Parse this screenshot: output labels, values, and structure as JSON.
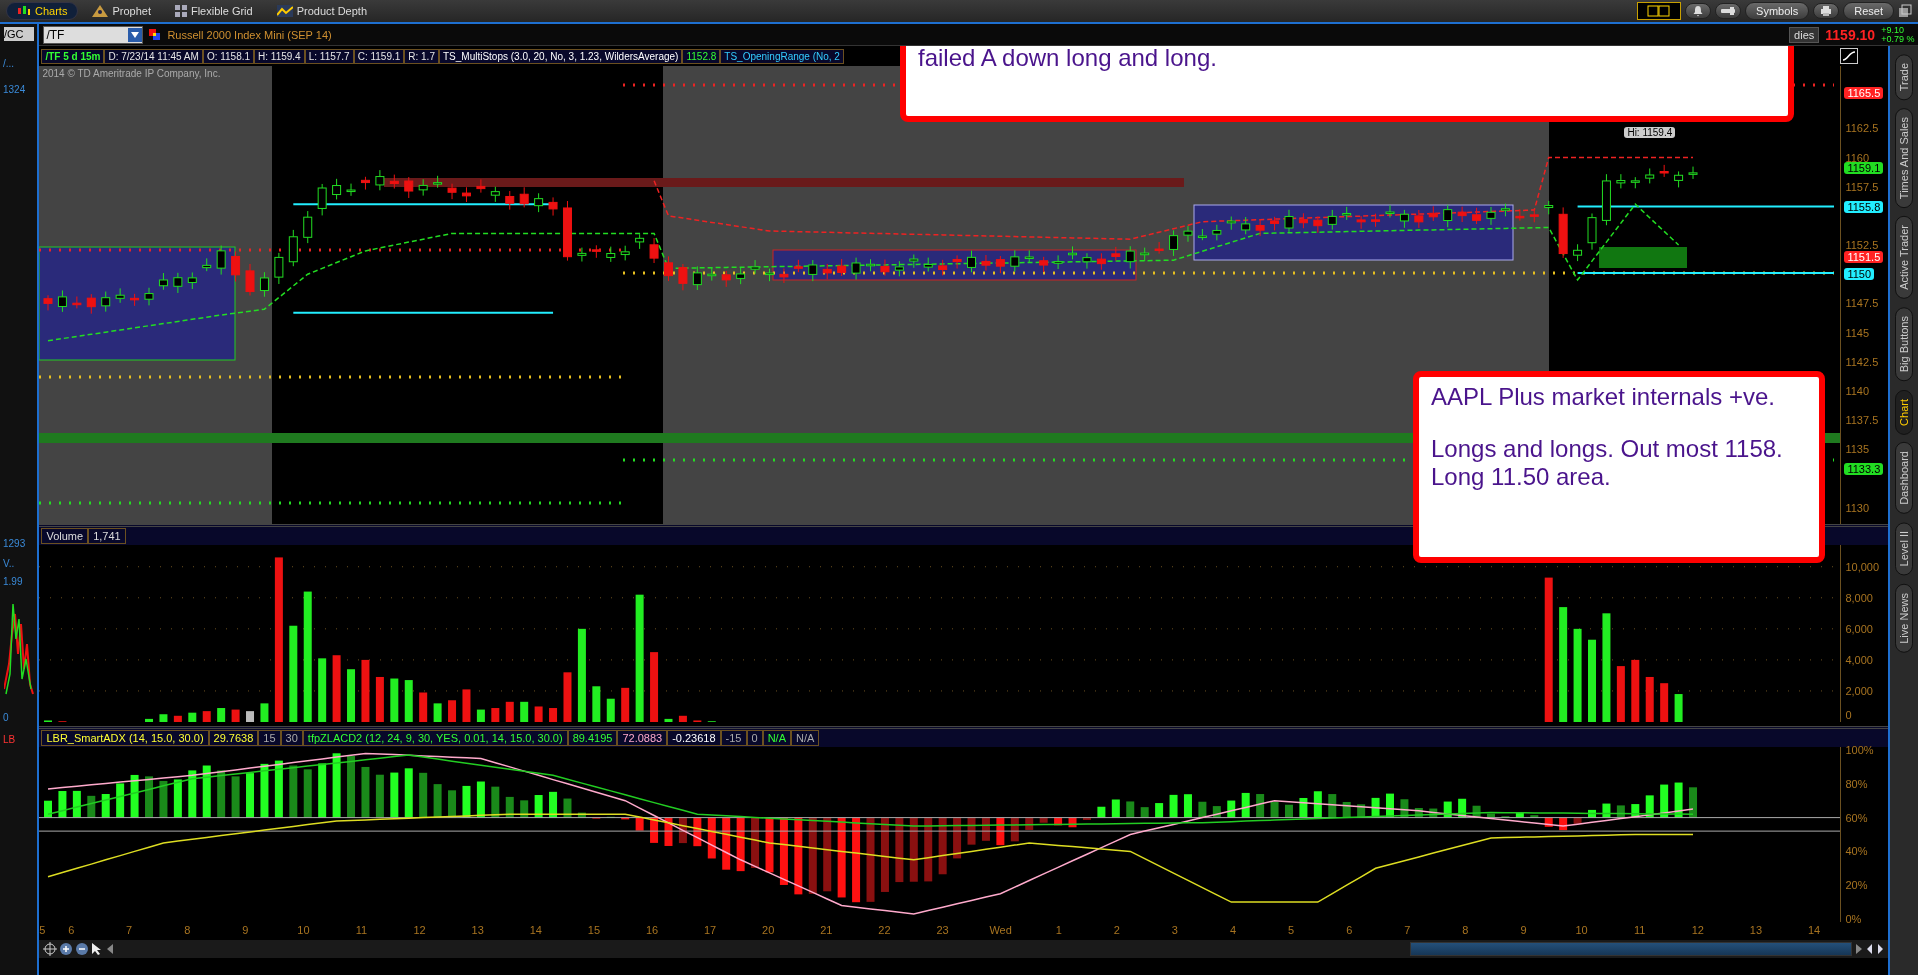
{
  "toolbar": {
    "tabs": [
      {
        "label": "Charts",
        "selected": true
      },
      {
        "label": "Prophet",
        "selected": false
      },
      {
        "label": "Flexible Grid",
        "selected": false
      },
      {
        "label": "Product Depth",
        "selected": false
      }
    ],
    "buttons": [
      "Symbols",
      "Reset"
    ]
  },
  "left_strip": {
    "symbol": "/GC",
    "texts": [
      "/...",
      "1324",
      "1293",
      "V..",
      "1.99",
      "0",
      "LB"
    ]
  },
  "chart": {
    "symbol": "/TF",
    "description": "Russell 2000 Index Mini (SEP 14)",
    "studies_button": "dies",
    "last": "1159.10",
    "change": "+9.10",
    "change_pct": "+0.79 %",
    "info": [
      {
        "text": "/TF 5 d 15m",
        "kind": "period"
      },
      {
        "text": "D: 7/23/14 11:45 AM",
        "kind": "field"
      },
      {
        "text": "O: 1158.1",
        "kind": "field"
      },
      {
        "text": "H: 1159.4",
        "kind": "field"
      },
      {
        "text": "L: 1157.7",
        "kind": "field"
      },
      {
        "text": "C: 1159.1",
        "kind": "field"
      },
      {
        "text": "R: 1.7",
        "kind": "field"
      },
      {
        "text": "TS_MultiStops (3.0, 20, No, 3, 1.23, WildersAverage)",
        "kind": "study"
      },
      {
        "text": "1152.8",
        "kind": "value"
      },
      {
        "text": "TS_OpeningRange (No, 2",
        "kind": "study2"
      }
    ],
    "copyright": "2014 © TD Ameritrade IP Company, Inc.",
    "high_label": "Hi: 1159.4",
    "price_axis": [
      "1162.5",
      "1160",
      "1157.5",
      "1152.5",
      "1147.5",
      "1145",
      "1142.5",
      "1140",
      "1137.5",
      "1135",
      "1130"
    ],
    "badges": [
      {
        "text": "1165.5",
        "color": "#ff2222"
      },
      {
        "text": "1159.1",
        "color": "#22dd22"
      },
      {
        "text": "1155.8",
        "color": "#22eeff"
      },
      {
        "text": "1151.5",
        "color": "#ff2222"
      },
      {
        "text": "1150",
        "color": "#22eeff"
      },
      {
        "text": "1133.3",
        "color": "#22dd22"
      }
    ]
  },
  "volume": {
    "title": "Volume",
    "value": "1,741",
    "axis": [
      "10,000",
      "8,000",
      "6,000",
      "4,000",
      "2,000",
      "0"
    ]
  },
  "indicator": {
    "cells": [
      {
        "text": "LBR_SmartADX (14, 15.0, 30.0)",
        "color": "#ffff33"
      },
      {
        "text": "29.7638",
        "color": "#ffff33"
      },
      {
        "text": "15",
        "color": "#aaaaaa"
      },
      {
        "text": "30",
        "color": "#aaaaaa"
      },
      {
        "text": "tfpZLACD2 (12, 24, 9, 30, YES, 0.01, 14, 15.0, 30.0)",
        "color": "#33ff33"
      },
      {
        "text": "89.4195",
        "color": "#33ff33"
      },
      {
        "text": "72.0883",
        "color": "#ffaacc"
      },
      {
        "text": "-0.23618",
        "color": "#ffffff"
      },
      {
        "text": "-15",
        "color": "#aaaaaa"
      },
      {
        "text": "0",
        "color": "#aaaaaa"
      },
      {
        "text": "N/A",
        "color": "#33ff33"
      },
      {
        "text": "N/A",
        "color": "#aaaaaa"
      }
    ],
    "axis": [
      "100%",
      "80%",
      "60%",
      "40%",
      "20%",
      "0%"
    ]
  },
  "time_axis": [
    "5",
    "6",
    "7",
    "8",
    "9",
    "10",
    "11",
    "12",
    "13",
    "14",
    "15",
    "16",
    "17",
    "20",
    "21",
    "22",
    "23",
    "Wed",
    "1",
    "2",
    "3",
    "4",
    "5",
    "6",
    "7",
    "8",
    "9",
    "10",
    "11",
    "12",
    "13",
    "14"
  ],
  "side_tabs": [
    {
      "label": "Trade",
      "selected": false
    },
    {
      "label": "Times And Sales",
      "selected": false
    },
    {
      "label": "Active Trader",
      "selected": false
    },
    {
      "label": "Big Buttons",
      "selected": false
    },
    {
      "label": "Chart",
      "selected": true
    },
    {
      "label": "Dashboard",
      "selected": false
    },
    {
      "label": "Level II",
      "selected": false
    },
    {
      "label": "Live News",
      "selected": false
    }
  ],
  "callouts": [
    {
      "paragraphs": [
        "failed A down long and long."
      ]
    },
    {
      "paragraphs": [
        "AAPL Plus market internals +ve.",
        "Longs and longs. Out most 1158. Long 11.50 area."
      ]
    }
  ]
}
